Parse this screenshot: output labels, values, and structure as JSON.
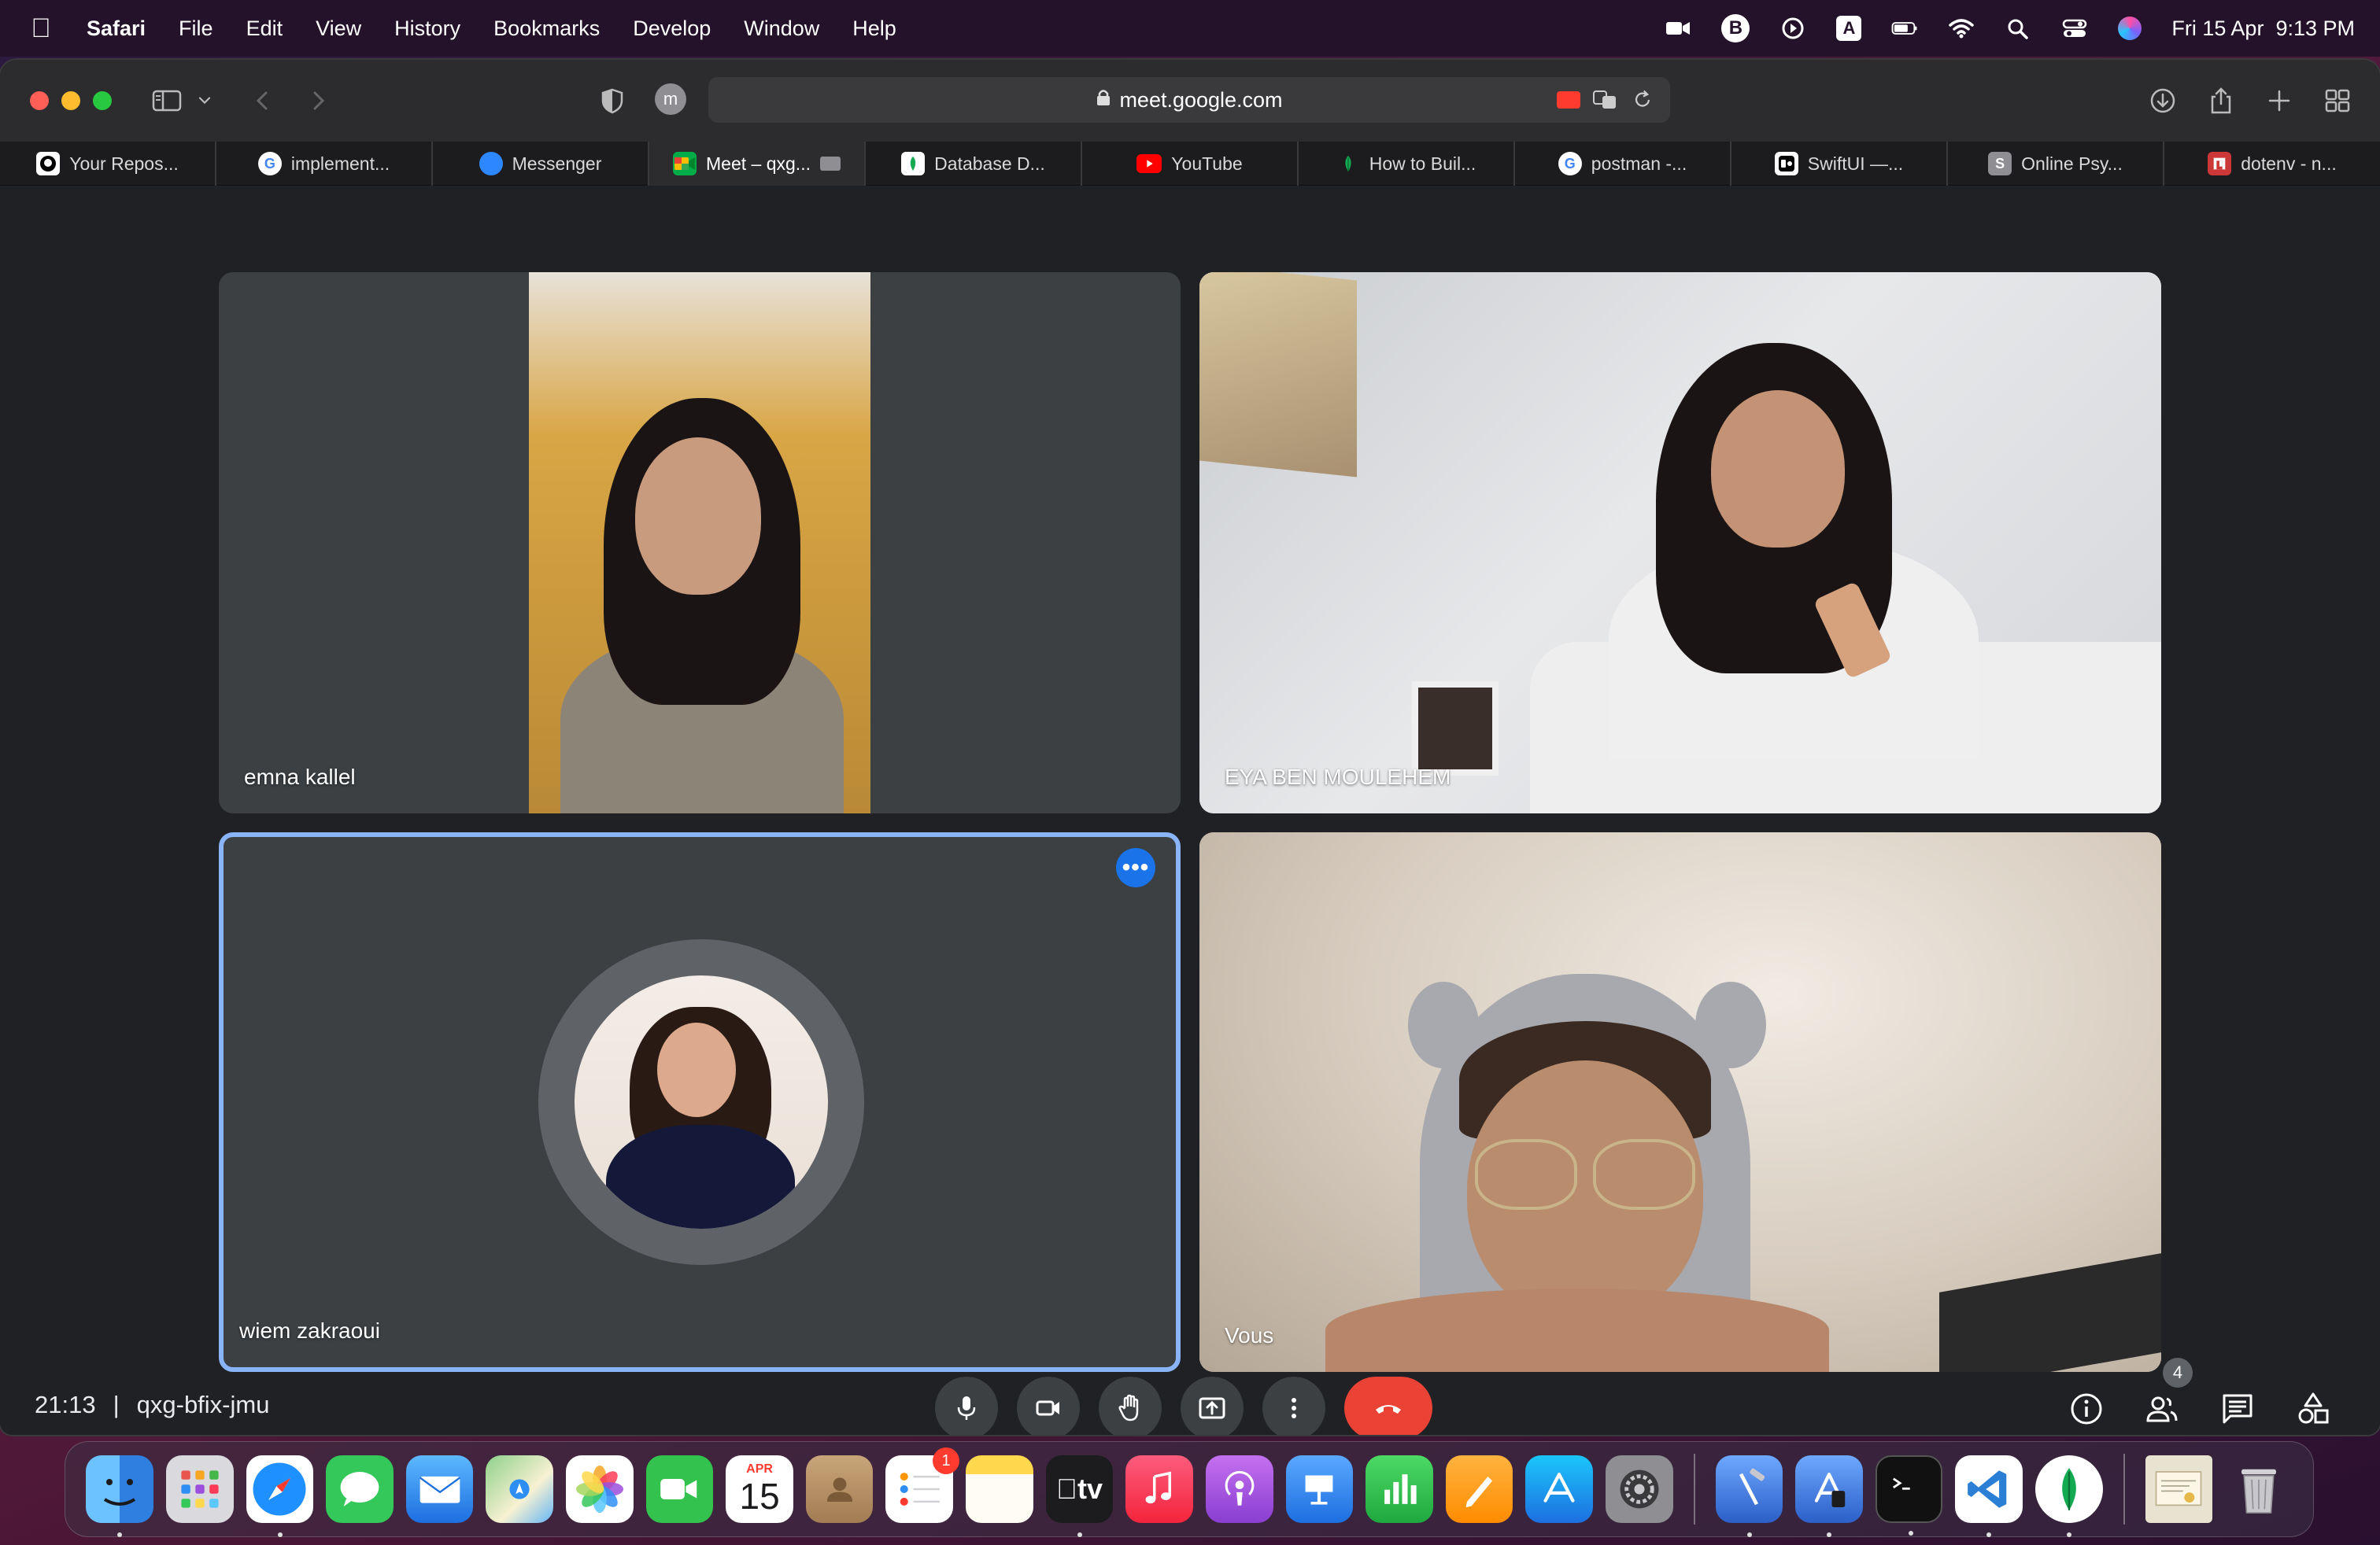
{
  "menubar": {
    "app_name": "Safari",
    "menus": [
      "File",
      "Edit",
      "View",
      "History",
      "Bookmarks",
      "Develop",
      "Window",
      "Help"
    ],
    "status_icons": [
      "video-camera-icon",
      "b-circle-icon",
      "play-circle-icon",
      "a-square-icon",
      "battery-icon",
      "wifi-icon",
      "spotlight-search-icon",
      "control-center-icon",
      "siri-icon"
    ],
    "b_label": "B",
    "a_label": "A",
    "clock": "Fri 15 Apr  9:13 PM"
  },
  "browser": {
    "url": "meet.google.com",
    "profile_initial": "m",
    "tabs": [
      {
        "label": "Your Repos...",
        "icon": "github-icon",
        "color": "#ffffff"
      },
      {
        "label": "implement...",
        "icon": "google-icon",
        "color": "#4285f4"
      },
      {
        "label": "Messenger",
        "icon": "messenger-icon",
        "color": "#2d88ff"
      },
      {
        "label": "Meet – qxg...",
        "icon": "google-meet-icon",
        "color": "#00ac47",
        "active": true
      },
      {
        "label": "Database D...",
        "icon": "mongodb-icon",
        "color": "#13aa52"
      },
      {
        "label": "YouTube",
        "icon": "youtube-icon",
        "color": "#ff0000"
      },
      {
        "label": "How to Buil...",
        "icon": "mongodb-leaf-icon",
        "color": "#13aa52"
      },
      {
        "label": "postman -...",
        "icon": "google-icon",
        "color": "#4285f4"
      },
      {
        "label": "SwiftUI —...",
        "icon": "swiftui-icon",
        "color": "#ffffff"
      },
      {
        "label": "Online Psy...",
        "icon": "s-icon",
        "color": "#8e8e93"
      },
      {
        "label": "dotenv - n...",
        "icon": "npm-icon",
        "color": "#cb3837"
      }
    ]
  },
  "meet": {
    "participants": [
      {
        "name": "emna kallel"
      },
      {
        "name": "EYA BEN MOULEHEM"
      },
      {
        "name": "wiem zakraoui",
        "camera_off": true,
        "speaking_highlight": true
      },
      {
        "name": "Vous"
      }
    ],
    "time": "21:13",
    "meeting_code": "qxg-bfix-jmu",
    "people_count": "4",
    "controls": [
      "microphone",
      "camera",
      "raise-hand",
      "present",
      "more-options",
      "leave-call"
    ],
    "side_controls": [
      "meeting-details",
      "people",
      "chat",
      "activities"
    ]
  },
  "dock": {
    "apps": [
      {
        "name": "Finder",
        "icon": "finder-icon",
        "color": "#3a8dde"
      },
      {
        "name": "Launchpad",
        "icon": "launchpad-icon",
        "color": "#d9d9de"
      },
      {
        "name": "Safari",
        "icon": "safari-icon",
        "color": "#1e90ff"
      },
      {
        "name": "Messages",
        "icon": "messages-icon",
        "color": "#34c759"
      },
      {
        "name": "Mail",
        "icon": "mail-icon",
        "color": "#2f8ef4"
      },
      {
        "name": "Maps",
        "icon": "maps-icon",
        "color": "#59c26a"
      },
      {
        "name": "Photos",
        "icon": "photos-icon",
        "color": "#f5f5f5"
      },
      {
        "name": "FaceTime",
        "icon": "facetime-icon",
        "color": "#33c24d"
      },
      {
        "name": "Calendar",
        "icon": "calendar-icon",
        "color": "#ffffff",
        "month": "APR",
        "day": "15"
      },
      {
        "name": "Contacts",
        "icon": "contacts-icon",
        "color": "#b8946a"
      },
      {
        "name": "Reminders",
        "icon": "reminders-icon",
        "color": "#ffffff",
        "badge": "1"
      },
      {
        "name": "Notes",
        "icon": "notes-icon",
        "color": "#ffd84d"
      },
      {
        "name": "TV",
        "icon": "apple-tv-icon",
        "color": "#1c1c1e",
        "label": "tv"
      },
      {
        "name": "Music",
        "icon": "music-icon",
        "color": "#fb3b56"
      },
      {
        "name": "Podcasts",
        "icon": "podcasts-icon",
        "color": "#9b4fdc"
      },
      {
        "name": "Keynote",
        "icon": "keynote-icon",
        "color": "#2e86f5"
      },
      {
        "name": "Numbers",
        "icon": "numbers-icon",
        "color": "#2fbe4f"
      },
      {
        "name": "Pages",
        "icon": "pages-icon",
        "color": "#ff9f0a"
      },
      {
        "name": "App Store",
        "icon": "app-store-icon",
        "color": "#1d8cf8"
      },
      {
        "name": "System Preferences",
        "icon": "system-preferences-icon",
        "color": "#8e8e93"
      },
      {
        "name": "Xcode",
        "icon": "xcode-icon",
        "color": "#3b7ee3"
      },
      {
        "name": "Simulator",
        "icon": "simulator-icon",
        "color": "#3b7ee3"
      },
      {
        "name": "Terminal",
        "icon": "terminal-icon",
        "color": "#111111"
      },
      {
        "name": "VS Code",
        "icon": "vscode-icon",
        "color": "#ffffff"
      },
      {
        "name": "MongoDB Compass",
        "icon": "mongodb-compass-icon",
        "color": "#ffffff"
      },
      {
        "name": "Certificate",
        "icon": "document-icon",
        "color": "#e8e2d0"
      },
      {
        "name": "Trash",
        "icon": "trash-icon",
        "color": "#c7c7cc"
      }
    ]
  }
}
